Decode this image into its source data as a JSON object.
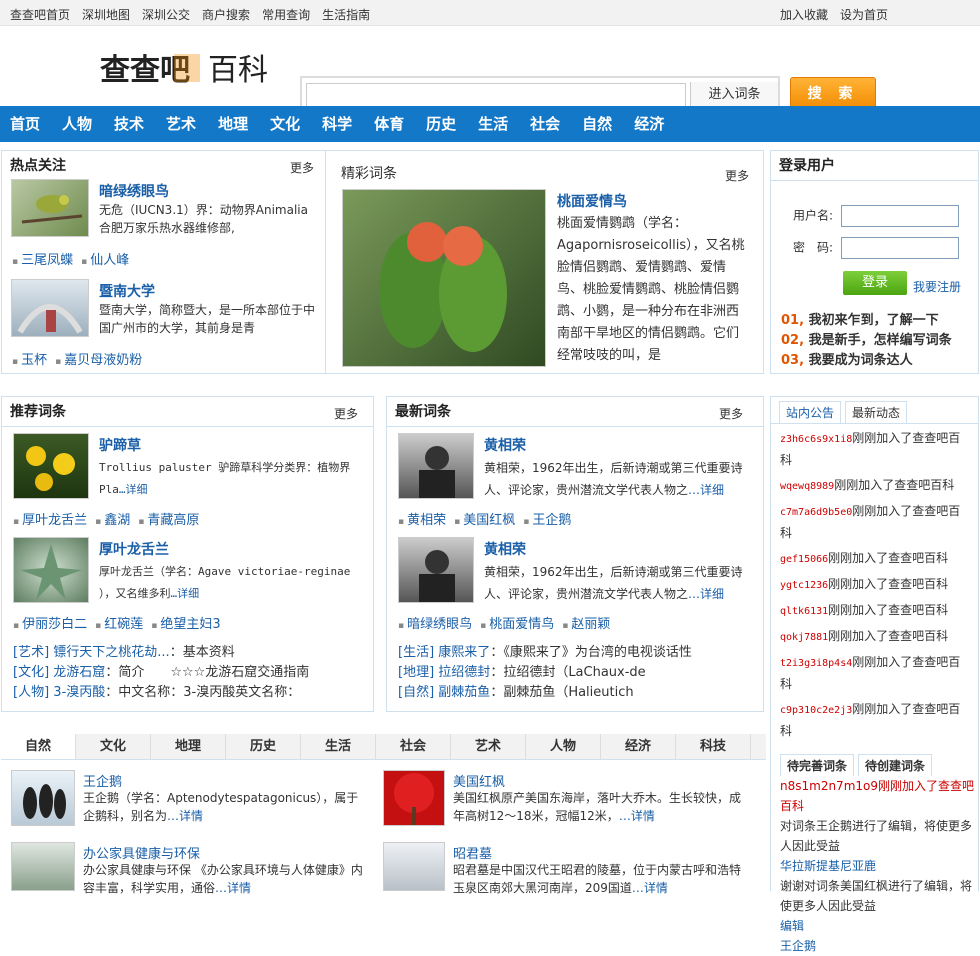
{
  "topbar": {
    "left": [
      "查查吧首页",
      "深圳地图",
      "深圳公交",
      "商户搜索",
      "常用查询",
      "生活指南"
    ],
    "right": [
      "加入收藏",
      "设为首页"
    ]
  },
  "header": {
    "logo_text_a": "查查吧",
    "logo_text_b": "百科",
    "search_placeholder": "",
    "entry_label": "进入词条",
    "search_button": "搜 索"
  },
  "nav": [
    "首页",
    "人物",
    "技术",
    "艺术",
    "地理",
    "文化",
    "科学",
    "体育",
    "历史",
    "生活",
    "社会",
    "自然",
    "经济"
  ],
  "hot": {
    "title": "热点关注",
    "more": "更多",
    "items": [
      {
        "title": "暗绿绣眼鸟",
        "desc": "无危（IUCN3.1）界：动物界Animalia合肥万家乐热水器维修部,",
        "links": [
          "三尾凤蝶",
          "仙人峰"
        ]
      },
      {
        "title": "暨南大学",
        "desc": "暨南大学，简称暨大，是一所本部位于中国广州市的大学，其前身是青",
        "links": [
          "玉杯",
          "嘉贝母液奶粉"
        ]
      }
    ]
  },
  "featured": {
    "title": "精彩词条",
    "more": "更多",
    "name": "桃面爱情鸟",
    "desc": "桃面爱情鹦鹉（学名：Agapornisroseicollis），又名桃脸情侣鹦鹉、爱情鹦鹉、爱情鸟、桃脸爱情鹦鹉、桃脸情侣鹦鹉、小鹦，是一种分布在非洲西南部干旱地区的情侣鹦鹉。它们经常吱吱的叫，是"
  },
  "login": {
    "title": "登录用户",
    "user_label": "用户名:",
    "pass_label": "密　码:",
    "login_button": "登录",
    "register": "我要注册",
    "guides": [
      {
        "num": "01,",
        "text": "我初来乍到，了解一下"
      },
      {
        "num": "02,",
        "text": "我是新手，怎样编写词条"
      },
      {
        "num": "03,",
        "text": "我要成为词条达人"
      }
    ]
  },
  "recommend": {
    "title": "推荐词条",
    "more": "更多",
    "items": [
      {
        "title": "驴蹄草",
        "desc_a": "Trollius paluster 驴蹄草科学分类界：植物界Pla",
        "detail": "…详细",
        "links": [
          "厚叶龙舌兰",
          "鑫湖",
          "青藏高原"
        ]
      },
      {
        "title": "厚叶龙舌兰",
        "desc_a": "厚叶龙舌兰（学名：Agave victoriae-reginae ），又名维多利",
        "detail": "…详细",
        "links": [
          "伊丽莎白二",
          "红碗莲",
          "绝望主妇3"
        ]
      }
    ],
    "tags": [
      {
        "cat": "[艺术]",
        "link": "镖行天下之桃花劫...",
        "desc": "：基本资料"
      },
      {
        "cat": "[文化]",
        "link": "龙游石窟",
        "desc": "：简介　　☆☆☆龙游石窟交通指南"
      },
      {
        "cat": "[人物]",
        "link": "3-溴丙酸",
        "desc": "：中文名称：3-溴丙酸英文名称："
      }
    ]
  },
  "latest": {
    "title": "最新词条",
    "more": "更多",
    "items": [
      {
        "title": "黄相荣",
        "desc": "黄相荣，1962年出生，后新诗潮或第三代重要诗人、评论家，贵州潜流文学代表人物之",
        "detail": "…详细",
        "links": [
          "黄相荣",
          "美国红枫",
          "王企鹅"
        ]
      },
      {
        "title": "黄相荣",
        "desc": "黄相荣，1962年出生，后新诗潮或第三代重要诗人、评论家，贵州潜流文学代表人物之",
        "detail": "…详细",
        "links": [
          "暗绿绣眼鸟",
          "桃面爱情鸟",
          "赵丽颖"
        ]
      }
    ],
    "tags": [
      {
        "cat": "[生活]",
        "link": "康熙来了",
        "desc": "：《康熙来了》为台湾的电视谈话性"
      },
      {
        "cat": "[地理]",
        "link": "拉绍德封",
        "desc": "：拉绍德封（LaChaux-de"
      },
      {
        "cat": "[自然]",
        "link": "副棘茄鱼",
        "desc": "：副棘茄鱼（Halieutich"
      }
    ]
  },
  "notice": {
    "tabs": [
      "站内公告",
      "最新动态"
    ],
    "feed": [
      {
        "user": "z3h6c6s9x1i8",
        "text": "刚刚加入了查查吧百科"
      },
      {
        "user": "wqewq8989",
        "text": "刚刚加入了查查吧百科"
      },
      {
        "user": "c7m7a6d9b5e0",
        "text": "刚刚加入了查查吧百科"
      },
      {
        "user": "gef15066",
        "text": "刚刚加入了查查吧百科"
      },
      {
        "user": "ygtc1236",
        "text": "刚刚加入了查查吧百科"
      },
      {
        "user": "qltk6131",
        "text": "刚刚加入了查查吧百科"
      },
      {
        "user": "qokj7881",
        "text": "刚刚加入了查查吧百科"
      },
      {
        "user": "t2i3g3i8p4s4",
        "text": "刚刚加入了查查吧百科"
      },
      {
        "user": "c9p310c2e2j3",
        "text": "刚刚加入了查查吧百科"
      }
    ],
    "tabs_b": [
      "待完善词条",
      "待创建词条"
    ],
    "overlap": [
      "n8s1m2n7m1o9刚刚加入了查查吧百科",
      "对词条王企鹅进行了编辑，将使更多人因此受益",
      "华拉斯提基尼亚鹿",
      "谢谢对词条美国红枫进行了编辑，将使更多人因此受益",
      "编辑",
      "王企鹅"
    ]
  },
  "cats": {
    "tabs": [
      "自然",
      "文化",
      "地理",
      "历史",
      "生活",
      "社会",
      "艺术",
      "人物",
      "经济",
      "科技"
    ],
    "items": [
      {
        "title": "王企鹅",
        "desc": "王企鹅（学名：Aptenodytespatagonicus），属于企鹅科，别名为",
        "detail": "…详情"
      },
      {
        "title": "美国红枫",
        "desc": "美国红枫原产美国东海岸，落叶大乔木。生长较快，成年高树12～18米，冠幅12米，",
        "detail": "…详情"
      },
      {
        "title": "办公家具健康与环保",
        "desc": "办公家具健康与环保 《办公家具环境与人体健康》内容丰富，科学实用，通俗",
        "detail": "…详情"
      },
      {
        "title": "昭君墓",
        "desc": "昭君墓是中国汉代王昭君的陵墓，位于内蒙古呼和浩特玉泉区南郊大黑河南岸，209国道",
        "detail": "…详情"
      }
    ]
  }
}
